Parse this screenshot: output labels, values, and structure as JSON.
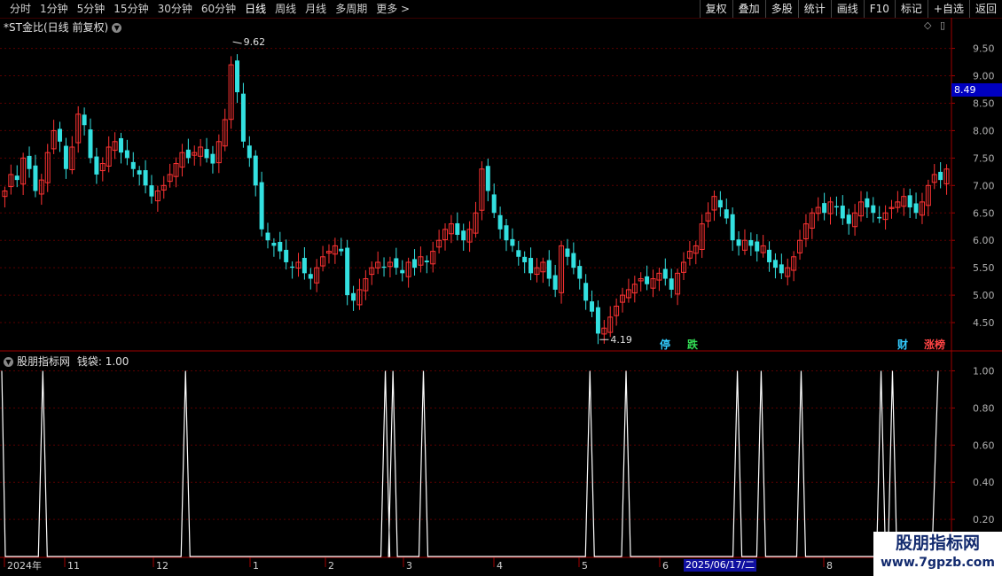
{
  "toolbar": {
    "periods": [
      "分时",
      "1分钟",
      "5分钟",
      "15分钟",
      "30分钟",
      "60分钟",
      "日线",
      "周线",
      "月线",
      "多周期",
      "更多 >"
    ],
    "active_period": "日线",
    "actions": [
      "复权",
      "叠加",
      "多股",
      "统计",
      "画线",
      "F10",
      "标记",
      "+自选",
      "返回"
    ]
  },
  "main_chart": {
    "title": "*ST金比(日线 前复权)",
    "high_label": "9.62",
    "low_label": "4.19",
    "current_price": "8.49",
    "y_ticks": [
      "9.50",
      "9.00",
      "8.50",
      "8.00",
      "7.50",
      "7.00",
      "6.50",
      "6.00",
      "5.50",
      "5.00",
      "4.50"
    ],
    "markers": [
      {
        "text": "停",
        "color": "#33ccff"
      },
      {
        "text": "跌",
        "color": "#33dd55"
      },
      {
        "text": "财",
        "color": "#33ccff"
      },
      {
        "text": "涨榜",
        "color": "#ff4444"
      }
    ]
  },
  "indicator": {
    "title": "股朋指标网",
    "series_label": "钱袋: 1.00",
    "y_ticks": [
      "1.00",
      "0.80",
      "0.60",
      "0.40",
      "0.20"
    ]
  },
  "x_axis": {
    "labels": [
      "2024年",
      "11",
      "12",
      "1",
      "2",
      "3",
      "4",
      "5",
      "6",
      "8"
    ],
    "cursor_date": "2025/06/17/二"
  },
  "watermark": {
    "line1": "股朋指标网",
    "line2": "www.7gpzb.com"
  },
  "chart_data": [
    {
      "type": "candlestick",
      "title": "*ST金比(日线 前复权)",
      "ylim": [
        4.0,
        9.8
      ],
      "high": 9.62,
      "low": 4.19,
      "current": 8.49,
      "x_labels": [
        "2024年",
        "11",
        "12",
        "1",
        "2",
        "3",
        "4",
        "5",
        "6",
        "8"
      ],
      "closes": [
        6.9,
        7.2,
        7.1,
        7.5,
        7.3,
        6.9,
        7.1,
        7.6,
        8.0,
        7.8,
        7.3,
        7.7,
        8.3,
        8.1,
        7.5,
        7.2,
        7.4,
        7.7,
        7.8,
        7.6,
        7.5,
        7.3,
        7.2,
        7.0,
        6.8,
        6.9,
        7.0,
        7.2,
        7.4,
        7.6,
        7.5,
        7.6,
        7.7,
        7.5,
        7.4,
        7.8,
        8.2,
        9.2,
        8.7,
        7.8,
        7.5,
        7.0,
        6.2,
        6.0,
        5.9,
        5.8,
        5.6,
        5.5,
        5.6,
        5.4,
        5.3,
        5.5,
        5.7,
        5.8,
        5.9,
        5.8,
        5.0,
        4.9,
        5.1,
        5.3,
        5.5,
        5.6,
        5.5,
        5.6,
        5.5,
        5.4,
        5.6,
        5.5,
        5.7,
        5.6,
        5.8,
        6.0,
        6.2,
        6.3,
        6.1,
        6.0,
        6.2,
        6.5,
        7.3,
        6.9,
        6.5,
        6.2,
        6.0,
        5.9,
        5.7,
        5.6,
        5.4,
        5.5,
        5.6,
        5.3,
        5.1,
        5.9,
        5.7,
        5.5,
        5.3,
        4.9,
        4.7,
        4.3,
        4.4,
        4.6,
        4.8,
        5.0,
        5.1,
        5.2,
        5.3,
        5.2,
        5.3,
        5.4,
        5.3,
        5.1,
        5.4,
        5.6,
        5.8,
        5.9,
        6.3,
        6.5,
        6.8,
        6.6,
        6.4,
        6.0,
        5.9,
        6.0,
        5.9,
        5.8,
        5.9,
        5.6,
        5.5,
        5.4,
        5.5,
        5.7,
        6.0,
        6.3,
        6.5,
        6.6,
        6.5,
        6.7,
        6.6,
        6.4,
        6.3,
        6.5,
        6.7,
        6.6,
        6.5,
        6.4,
        6.5,
        6.6,
        6.7,
        6.8,
        6.6,
        6.5,
        6.7,
        7.0,
        7.2,
        7.1,
        7.3
      ]
    },
    {
      "type": "line",
      "title": "股朋指标网",
      "series": [
        {
          "name": "钱袋",
          "last": 1.0
        }
      ],
      "ylim": [
        0,
        1.05
      ],
      "spike_positions_x_fraction": [
        0.045,
        0.195,
        0.405,
        0.413,
        0.445,
        0.62,
        0.658,
        0.775,
        0.8,
        0.842,
        0.926,
        0.938
      ],
      "baseline": 0.0,
      "peak": 1.0
    }
  ]
}
